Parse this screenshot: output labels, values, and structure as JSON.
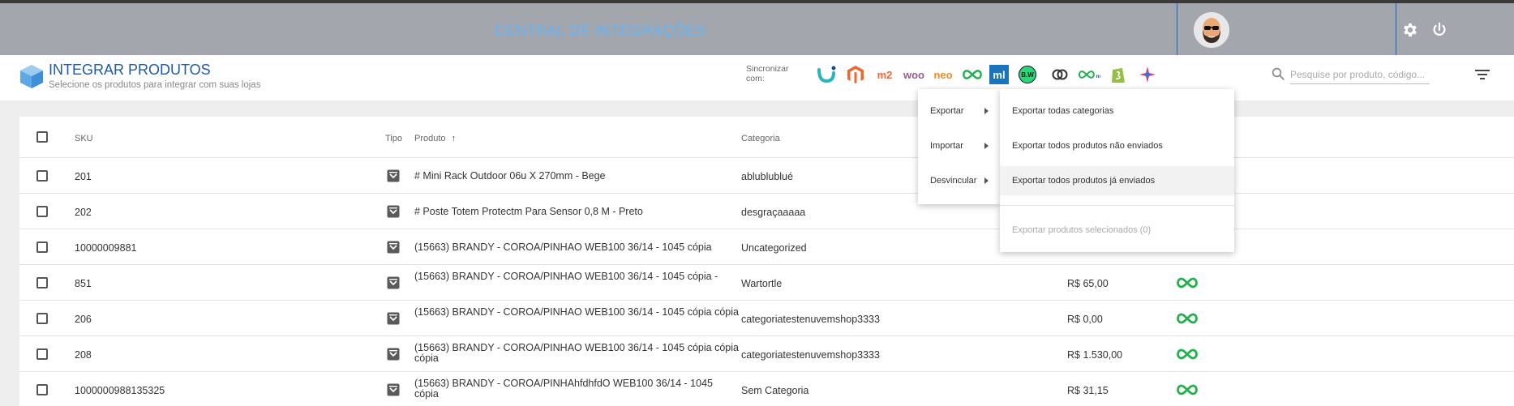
{
  "topbar": {
    "title": "CENTRAL DE INTEGRAÇÕES",
    "settings_icon": "gear-icon",
    "power_icon": "power-icon"
  },
  "header": {
    "title": "INTEGRAR PRODUTOS",
    "subtitle": "Selecione os produtos para integrar com suas lojas",
    "sync_label": "Sincronizar com:",
    "sync_icons": [
      {
        "name": "u-icon",
        "text": "",
        "color": "#2bb3c0"
      },
      {
        "name": "magento-icon",
        "text": "",
        "color": "#ee672f"
      },
      {
        "name": "magento2-icon",
        "text": "m2",
        "color": "#ee672f"
      },
      {
        "name": "woocommerce-icon",
        "text": "woo",
        "color": "#9b5c8f"
      },
      {
        "name": "neo-icon",
        "text": "neo",
        "color": "#f08a24"
      },
      {
        "name": "infinity-icon",
        "text": "",
        "color": "#22b14c"
      },
      {
        "name": "mercadolivre-icon",
        "text": "ml",
        "color": "#ffffff"
      },
      {
        "name": "bw-icon",
        "text": "B.W",
        "color": "#1a1a1a"
      },
      {
        "name": "rings-icon",
        "text": "",
        "color": "#333333"
      },
      {
        "name": "nuvem-icon",
        "text": "",
        "color": "#22b14c"
      },
      {
        "name": "shopify-icon",
        "text": "",
        "color": "#95bf47"
      },
      {
        "name": "star-icon",
        "text": "",
        "color": "#e23b7a"
      }
    ],
    "search_placeholder": "Pesquise por produto, código..."
  },
  "table": {
    "columns": {
      "sku": "SKU",
      "tipo": "Tipo",
      "produto": "Produto",
      "produto_sort": "↑",
      "categoria": "Categoria"
    },
    "rows": [
      {
        "sku": "201",
        "produto": "# Mini Rack Outdoor 06u X 270mm - Bege",
        "categoria": "ablublublué",
        "preco": "",
        "integrated": false
      },
      {
        "sku": "202",
        "produto": "# Poste Totem Protectm Para Sensor 0,8 M - Preto",
        "categoria": "desgraçaaaaa",
        "preco": "",
        "integrated": false
      },
      {
        "sku": "10000009881",
        "produto": "(15663) BRANDY - COROA/PINHAO WEB100 36/14 - 1045 cópia",
        "categoria": "Uncategorized",
        "preco": "",
        "integrated": false
      },
      {
        "sku": "851",
        "produto": "(15663) BRANDY - COROA/PINHAO WEB100 36/14 - 1045 cópia -",
        "categoria": "Wartortle",
        "preco": "R$ 65,00",
        "integrated": true
      },
      {
        "sku": "206",
        "produto": "(15663) BRANDY - COROA/PINHAO WEB100 36/14 - 1045 cópia cópia",
        "categoria": "categoriatestenuvemshop3333",
        "preco": "R$ 0,00",
        "integrated": true
      },
      {
        "sku": "208",
        "produto": "(15663) BRANDY - COROA/PINHAO WEB100 36/14 - 1045 cópia cópia cópia",
        "categoria": "categoriatestenuvemshop3333",
        "preco": "R$ 1.530,00",
        "integrated": true
      },
      {
        "sku": "1000000988135325",
        "produto": "(15663) BRANDY - COROA/PINHAhfdhfdO WEB100 36/14 - 1045 cópia",
        "categoria": "Sem Categoria",
        "preco": "R$ 31,15",
        "integrated": true
      }
    ]
  },
  "menu": {
    "items": [
      {
        "label": "Exportar"
      },
      {
        "label": "Importar"
      },
      {
        "label": "Desvincular"
      }
    ],
    "submenu": [
      {
        "label": "Exportar todas categorias",
        "state": "normal"
      },
      {
        "label": "Exportar todos produtos não enviados",
        "state": "normal"
      },
      {
        "label": "Exportar todos produtos já enviados",
        "state": "active"
      },
      {
        "label": "Exportar produtos selecionados (0)",
        "state": "disabled"
      }
    ]
  },
  "colors": {
    "accent": "#1e5aa8",
    "topbar": "#a4a6ae",
    "integration_green": "#22b14c"
  }
}
